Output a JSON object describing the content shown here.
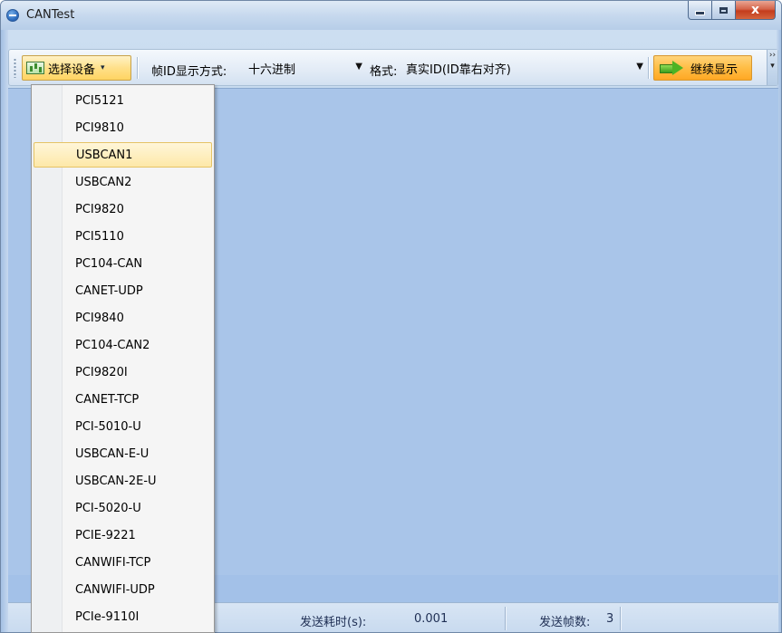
{
  "window": {
    "title": "CANTest",
    "controls": {
      "minimize": "minimize",
      "maximize": "maximize",
      "close": "x"
    }
  },
  "toolbar": {
    "device_button_label": "选择设备",
    "frame_id_label": "帧ID显示方式:",
    "frame_id_value": "十六进制",
    "format_label": "格式:",
    "format_value": "真实ID(ID靠右对齐)",
    "continue_label": "继续显示",
    "overflow": "›› ▾"
  },
  "device_menu": {
    "items": [
      "PCI5121",
      "PCI9810",
      "USBCAN1",
      "USBCAN2",
      "PCI9820",
      "PCI5110",
      "PC104-CAN",
      "CANET-UDP",
      "PCI9840",
      "PC104-CAN2",
      "PCI9820I",
      "CANET-TCP",
      "PCI-5010-U",
      "USBCAN-E-U",
      "USBCAN-2E-U",
      "PCI-5020-U",
      "PCIE-9221",
      "CANWIFI-TCP",
      "CANWIFI-UDP",
      "PCIe-9110I"
    ],
    "highlighted": "USBCAN1"
  },
  "statusbar": {
    "send_time_label": "发送耗时(s):",
    "send_time_value": "0.001",
    "send_frames_label": "发送帧数:",
    "send_frames_value": "3"
  },
  "colors": {
    "client_bg": "#a9c5e9",
    "highlight": "#fde8a8",
    "continue_button": "#ffbd45"
  }
}
